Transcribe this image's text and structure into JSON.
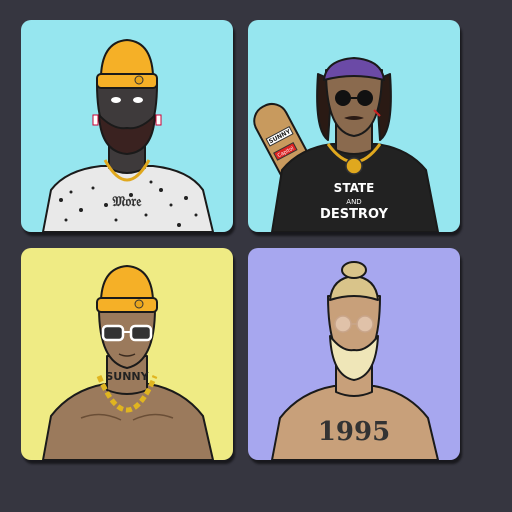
{
  "cards": [
    {
      "background": "#96e6ef",
      "skin": "#3e3a3b",
      "hat_color": "#f5b027",
      "shirt_text": "",
      "tattoo_text": ""
    },
    {
      "background": "#96e6ef",
      "skin": "#8a6a4e",
      "bandana_color": "#6b4aa6",
      "shirt_color": "#222222",
      "shirt_text_line1": "STATE",
      "shirt_text_line2": "AND",
      "shirt_text_line3": "DESTROY",
      "board_sticker_1": "SUNNY",
      "board_sticker_2": "Capitol"
    },
    {
      "background": "#efeb84",
      "skin": "#9b7a5c",
      "hat_color": "#f5b027",
      "collar_text": "SUNNY"
    },
    {
      "background": "#a7a7ef",
      "skin": "#c8a07a",
      "beard_color": "#efe6b8",
      "tattoo_text": "1995"
    }
  ]
}
